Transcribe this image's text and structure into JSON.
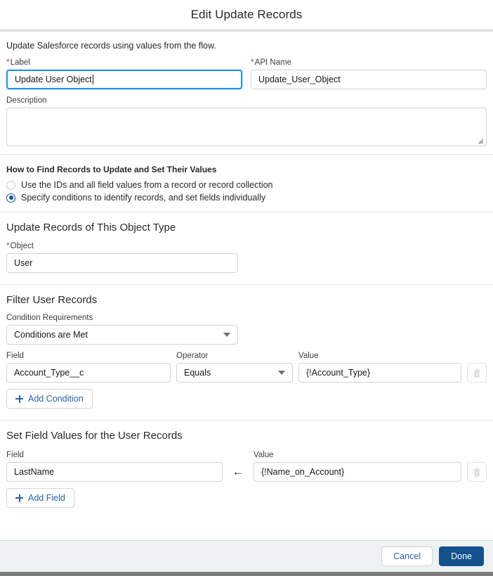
{
  "dialog": {
    "title": "Edit Update Records",
    "intro": "Update Salesforce records using values from the flow."
  },
  "label_field": {
    "label": "Label",
    "required_marker": "*",
    "value": "Update User Object"
  },
  "api_name_field": {
    "label": "API Name",
    "required_marker": "*",
    "value": "Update_User_Object"
  },
  "description_field": {
    "label": "Description",
    "value": "",
    "resize_grip": "◢"
  },
  "how_to_find": {
    "title": "How to Find Records to Update and Set Their Values",
    "options": [
      {
        "label": "Use the IDs and all field values from a record or record collection",
        "selected": false
      },
      {
        "label": "Specify conditions to identify records, and set fields individually",
        "selected": true
      }
    ]
  },
  "object_section": {
    "heading": "Update Records of This Object Type",
    "object_label": "Object",
    "required_marker": "*",
    "object_value": "User"
  },
  "filter_section": {
    "heading": "Filter User Records",
    "condition_requirements_label": "Condition Requirements",
    "condition_requirements_value": "Conditions are Met",
    "columns": {
      "field": "Field",
      "operator": "Operator",
      "value": "Value"
    },
    "conditions": [
      {
        "field": "Account_Type__c",
        "operator": "Equals",
        "value": "{!Account_Type}"
      }
    ],
    "add_condition_label": "Add Condition"
  },
  "set_values_section": {
    "heading": "Set Field Values for the User Records",
    "columns": {
      "field": "Field",
      "value": "Value"
    },
    "assign_arrow": "←",
    "assignments": [
      {
        "field": "LastName",
        "value": "{!Name_on_Account}"
      }
    ],
    "add_field_label": "Add Field"
  },
  "footer": {
    "cancel_label": "Cancel",
    "done_label": "Done"
  },
  "colors": {
    "brand_blue": "#14508c",
    "link_blue": "#2b5fab",
    "focus_blue": "#1b96e8",
    "required_red": "#c23934",
    "footer_bg": "#eef1f2",
    "border_grey": "#d4d4d4"
  }
}
